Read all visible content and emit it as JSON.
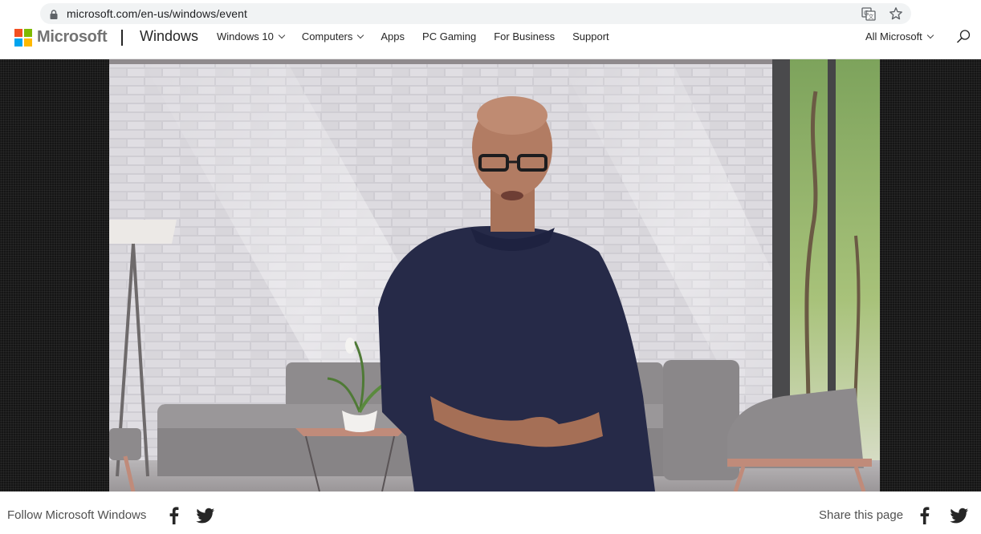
{
  "browser": {
    "url": "microsoft.com/en-us/windows/event",
    "icons": [
      "lock-icon",
      "translate-icon",
      "bookmark-star-icon"
    ]
  },
  "header": {
    "logo_text": "Microsoft",
    "brand": "Windows",
    "nav": [
      {
        "label": "Windows 10",
        "dropdown": true
      },
      {
        "label": "Computers",
        "dropdown": true
      },
      {
        "label": "Apps",
        "dropdown": false
      },
      {
        "label": "PC Gaming",
        "dropdown": false
      },
      {
        "label": "For Business",
        "dropdown": false
      },
      {
        "label": "Support",
        "dropdown": false
      }
    ],
    "all_microsoft": "All Microsoft",
    "search_icon": "search-icon"
  },
  "video": {
    "scene": "presenter-in-living-room"
  },
  "footer": {
    "follow_label": "Follow Microsoft Windows",
    "share_label": "Share this page",
    "icons": [
      "facebook-icon",
      "twitter-icon"
    ]
  },
  "colors": {
    "ms_red": "#f25022",
    "ms_green": "#7fba00",
    "ms_blue": "#00a4ef",
    "ms_yellow": "#ffb900",
    "backdrop": "#151515"
  }
}
